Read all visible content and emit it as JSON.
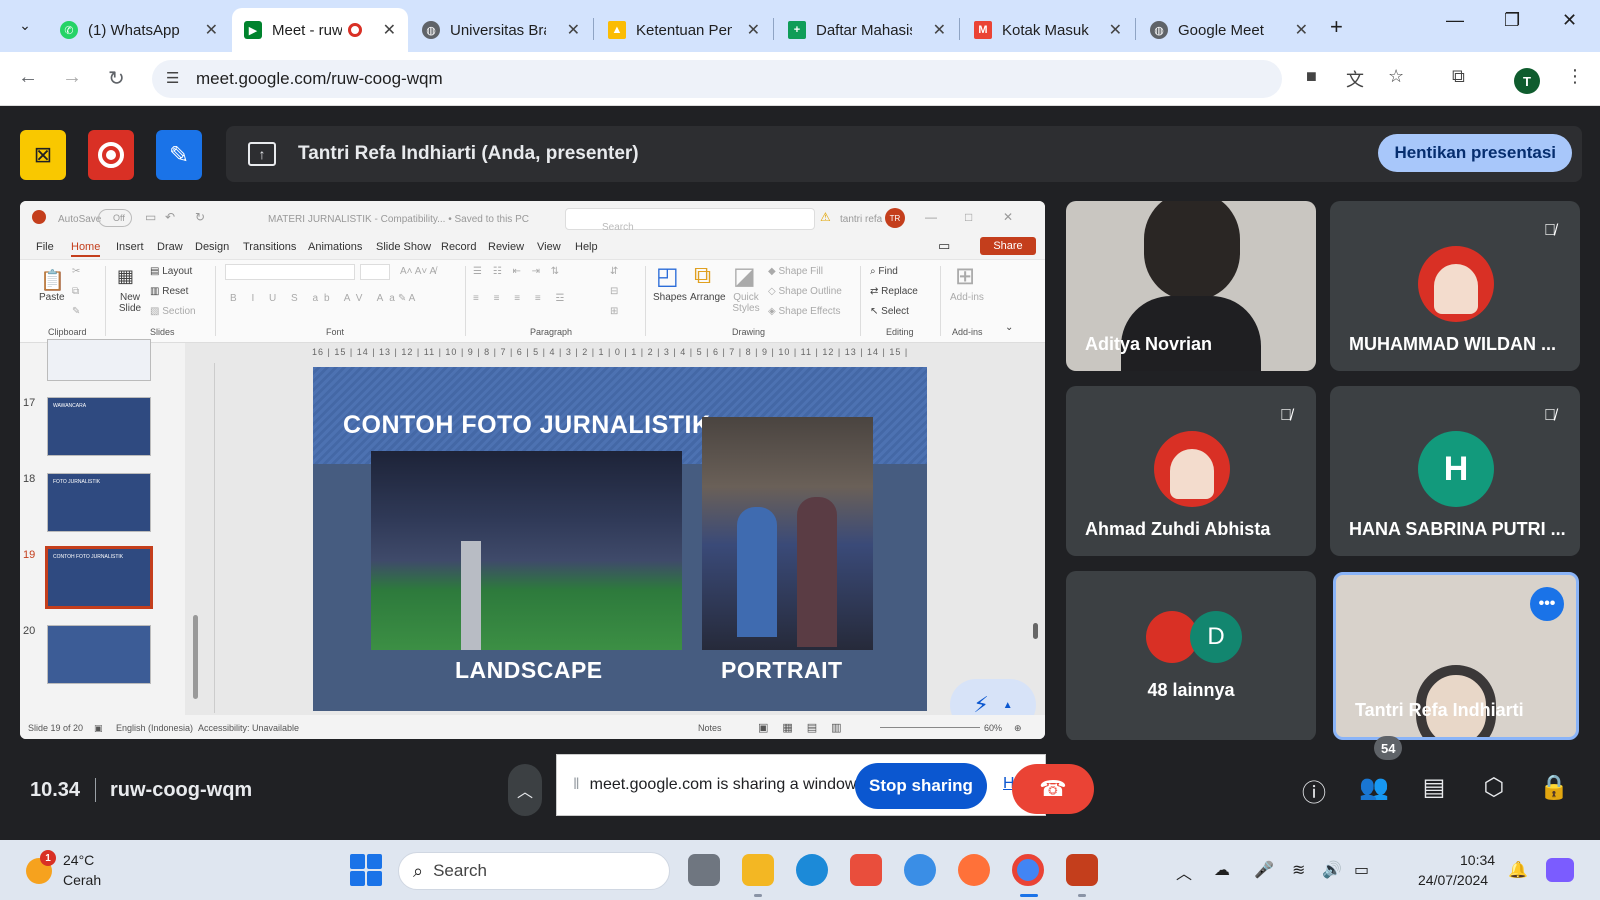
{
  "browser": {
    "tabs": [
      {
        "label": "(1) WhatsApp",
        "icon": "whatsapp-icon",
        "color": "#25d366"
      },
      {
        "label": "Meet - ruw-coog-wqm",
        "icon": "google-meet-icon",
        "color": "#00832d",
        "active": true
      },
      {
        "label": "Universitas Brawijaya",
        "icon": "globe-icon",
        "color": "#5f6368"
      },
      {
        "label": "Ketentuan Penulisan",
        "icon": "google-drive-icon",
        "color": "#fbbc04"
      },
      {
        "label": "Daftar Mahasiswa",
        "icon": "google-sheets-icon",
        "color": "#0f9d58"
      },
      {
        "label": "Kotak Masuk",
        "icon": "gmail-icon",
        "color": "#ea4335"
      },
      {
        "label": "Google Meet",
        "icon": "globe-icon",
        "color": "#5f6368"
      }
    ],
    "url": "meet.google.com/ruw-coog-wqm",
    "profile_initial": "T"
  },
  "presenter_bar": {
    "banner_text": "Tantri Refa Indhiarti (Anda, presenter)",
    "stop_presenting_label": "Hentikan presentasi"
  },
  "powerpoint": {
    "doc_title": "MATERI JURNALISTIK - Compatibility... • Saved to this PC",
    "autosave_label": "AutoSave",
    "autosave_state": "Off",
    "search_placeholder": "Search",
    "user_name": "tantri refa",
    "user_initials": "TR",
    "share_label": "Share",
    "menu": [
      "File",
      "Home",
      "Insert",
      "Draw",
      "Design",
      "Transitions",
      "Animations",
      "Slide Show",
      "Record",
      "Review",
      "View",
      "Help"
    ],
    "active_menu": "Home",
    "ribbon": {
      "paste": "Paste",
      "new_slide": "New Slide",
      "layout": "Layout",
      "reset": "Reset",
      "section": "Section",
      "shapes": "Shapes",
      "arrange": "Arrange",
      "quick_styles": "Quick Styles",
      "shape_fill": "Shape Fill",
      "shape_outline": "Shape Outline",
      "shape_effects": "Shape Effects",
      "find": "Find",
      "replace": "Replace",
      "select": "Select",
      "add_ins": "Add-ins",
      "groups": [
        "Clipboard",
        "Slides",
        "Font",
        "Paragraph",
        "Drawing",
        "Editing",
        "Add-ins"
      ]
    },
    "thumbnails": [
      {
        "num": "17",
        "title": "WAWANCARA"
      },
      {
        "num": "18",
        "title": "FOTO JURNALISTIK"
      },
      {
        "num": "19",
        "title": "CONTOH FOTO JURNALISTIK",
        "selected": true
      },
      {
        "num": "20",
        "title": ""
      }
    ],
    "ruler_text": "16 | 15 | 14 | 13 | 12 | 11 | 10 | 9 | 8 | 7 | 6 | 5 | 4 | 3 | 2 | 1 | 0 | 1 | 2 | 3 | 4 | 5 | 6 | 7 | 8 | 9 | 10 | 11 | 12 | 13 | 14 | 15 | 16",
    "slide": {
      "title": "CONTOH FOTO JURNALISTIK",
      "caption_left": "LANDSCAPE",
      "caption_right": "PORTRAIT"
    },
    "status": {
      "slide_info": "Slide 19 of 20",
      "language": "English (Indonesia)",
      "accessibility": "Accessibility: Unavailable",
      "notes": "Notes",
      "zoom": "60%"
    }
  },
  "participants": [
    {
      "name": "Aditya Novrian",
      "muted": false,
      "video": true
    },
    {
      "name": "MUHAMMAD WILDAN ...",
      "muted": true,
      "video": false
    },
    {
      "name": "Ahmad Zuhdi Abhista",
      "muted": true,
      "video": false
    },
    {
      "name": "HANA SABRINA PUTRI ...",
      "muted": true,
      "video": false,
      "initial": "H",
      "avatar_color": "#129a7c"
    },
    {
      "name": "48 lainnya",
      "extra_initial": "D",
      "extra_color": "#12866f"
    },
    {
      "name": "Tantri Refa Indhiarti",
      "self": true
    }
  ],
  "meeting": {
    "time": "10.34",
    "code": "ruw-coog-wqm",
    "participant_count": "54"
  },
  "share_notice": {
    "message": "meet.google.com is sharing a window.",
    "stop_label": "Stop sharing",
    "hide_label": "Hide"
  },
  "taskbar": {
    "weather_temp": "24°C",
    "weather_desc": "Cerah",
    "weather_badge": "1",
    "search_label": "Search",
    "clock_time": "10:34",
    "clock_date": "24/07/2024"
  }
}
